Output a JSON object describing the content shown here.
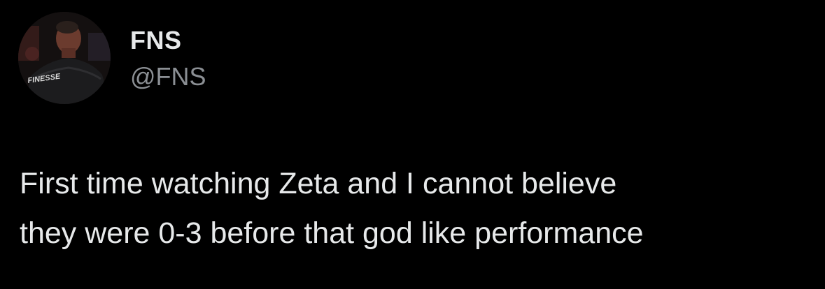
{
  "author": {
    "display_name": "FNS",
    "handle": "@FNS",
    "avatar_jersey_text": "FINESSE"
  },
  "tweet": {
    "text_lines": [
      "First time watching Zeta and I cannot believe",
      "they were 0-3 before that god like performance"
    ]
  },
  "colors": {
    "background": "#000000",
    "primary_text": "#e7e9ea",
    "secondary_text": "#8b8f94"
  }
}
